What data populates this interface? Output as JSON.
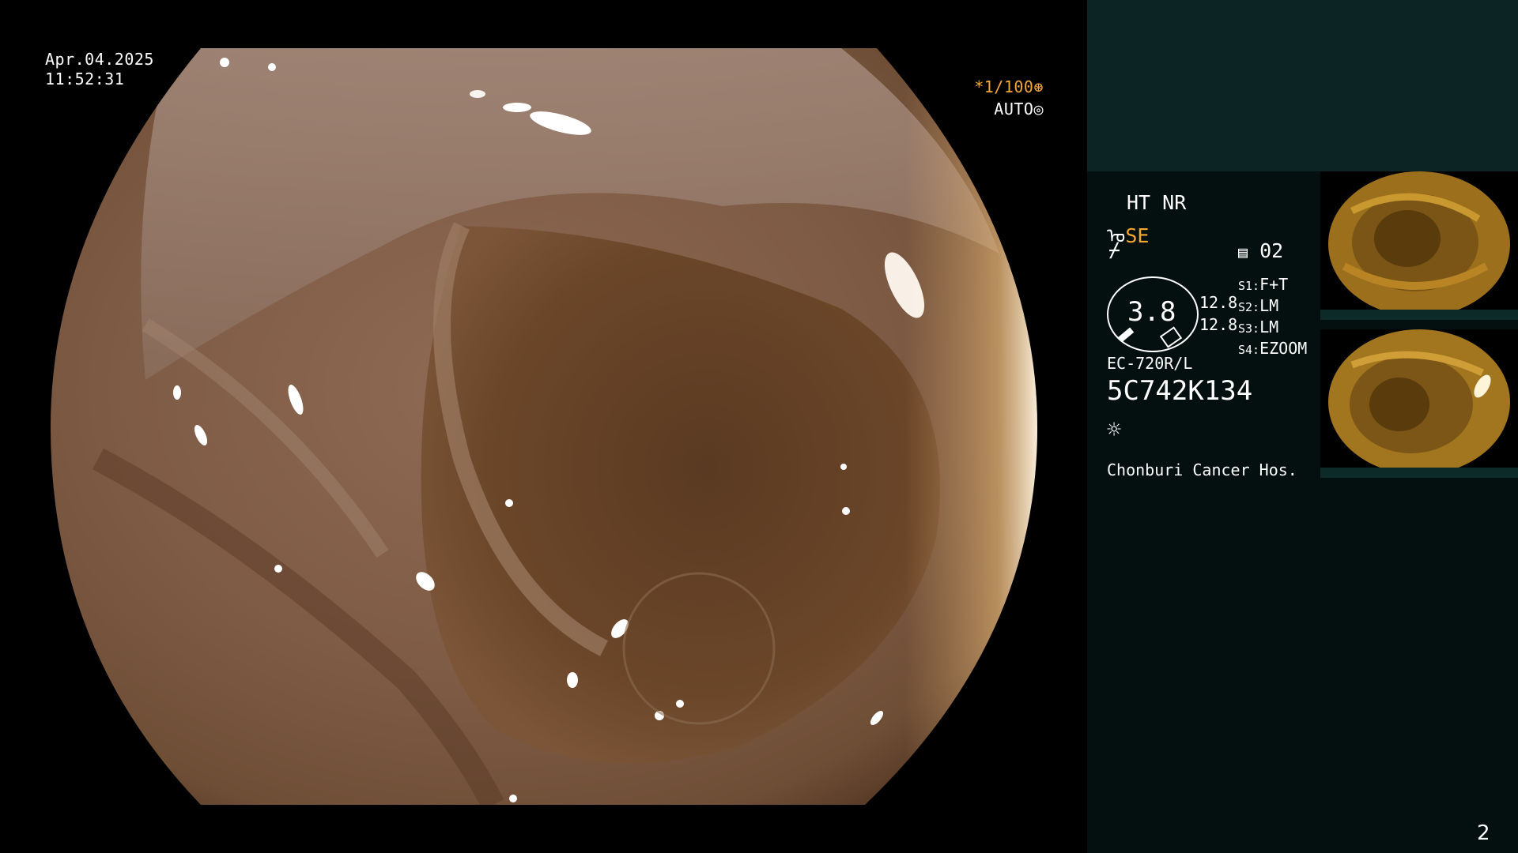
{
  "overlay": {
    "date": "Apr.04.2025",
    "time": "11:52:31",
    "shutter": "*1/100",
    "exposure": "AUTO"
  },
  "panel": {
    "modes": "HT NR",
    "se_label": "SE",
    "memory_label": "02",
    "gauge_value": "3.8",
    "scale_top": "12.8",
    "scale_bottom": "12.8",
    "switches": [
      {
        "key": "S1:",
        "value": "F+T"
      },
      {
        "key": "S2:",
        "value": "LM"
      },
      {
        "key": "S3:",
        "value": "LM"
      },
      {
        "key": "S4:",
        "value": "EZOOM"
      }
    ],
    "scope_model": "EC-720R/L",
    "serial": "5C742K134",
    "hospital": "Chonburi Cancer Hos."
  },
  "page_number": "2",
  "icons": {
    "shutter_icon": "aperture-icon",
    "exposure_icon": "auto-target-icon",
    "light_icon": "light-sun-icon",
    "memory_icon": "memory-card-icon"
  },
  "colors": {
    "accent_orange": "#f2a833",
    "panel_bg": "#04100f",
    "panel_top_bg": "#0d2424"
  }
}
